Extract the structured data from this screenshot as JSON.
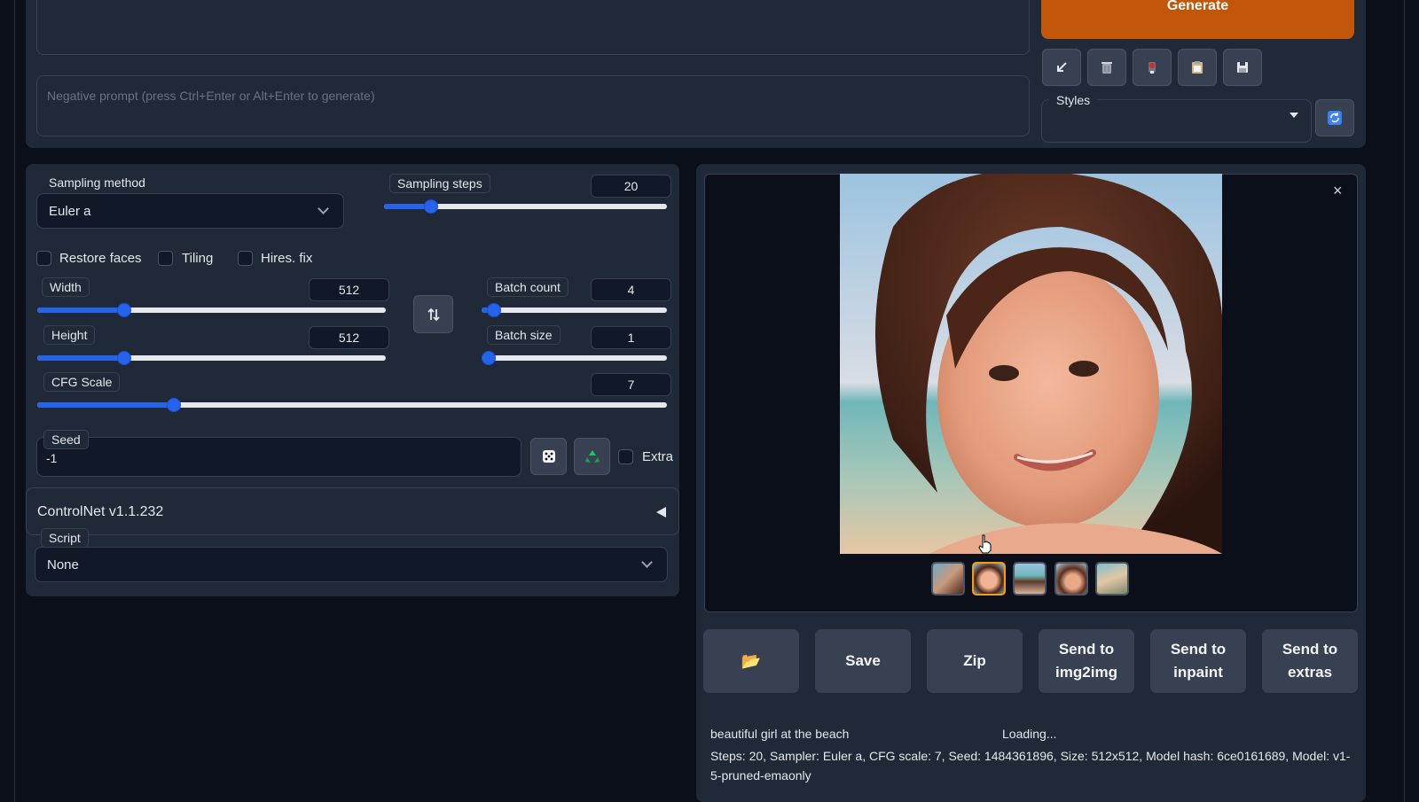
{
  "prompt": {
    "negative_placeholder": "Negative prompt (press Ctrl+Enter or Alt+Enter to generate)"
  },
  "generate_label": "Generate",
  "styles_label": "Styles",
  "toolbar_icons": [
    "arrow-down-left-icon",
    "trash-icon",
    "red-button-icon",
    "clipboard-icon",
    "floppy-disk-icon"
  ],
  "sampling": {
    "method_label": "Sampling method",
    "method_value": "Euler a",
    "steps_label": "Sampling steps",
    "steps_value": "20",
    "steps_fraction": 0.15
  },
  "checkboxes": {
    "restore_faces": "Restore faces",
    "tiling": "Tiling",
    "hires_fix": "Hires. fix"
  },
  "width": {
    "label": "Width",
    "value": "512",
    "fraction": 0.24
  },
  "height": {
    "label": "Height",
    "value": "512",
    "fraction": 0.24
  },
  "batch_count": {
    "label": "Batch count",
    "value": "4",
    "fraction": 0.03
  },
  "batch_size": {
    "label": "Batch size",
    "value": "1",
    "fraction": 0.0
  },
  "cfg": {
    "label": "CFG Scale",
    "value": "7",
    "fraction": 0.21
  },
  "seed": {
    "label": "Seed",
    "value": "-1",
    "extra_label": "Extra"
  },
  "controlnet_label": "ControlNet v1.1.232",
  "script": {
    "label": "Script",
    "value": "None"
  },
  "buttons": {
    "folder": "📂",
    "save": "Save",
    "zip": "Zip",
    "send_img2img": "Send to\nimg2img",
    "send_inpaint": "Send to\ninpaint",
    "send_extras": "Send to\nextras"
  },
  "info": {
    "prompt_text": "beautiful girl at the beach",
    "loading": "Loading...",
    "params": "Steps: 20, Sampler: Euler a, CFG scale: 7, Seed: 1484361896, Size: 512x512, Model hash: 6ce0161689, Model: v1-5-pruned-emaonly"
  },
  "colors": {
    "accent": "#2563eb",
    "generate": "#c2570a",
    "background": "#0b0f19",
    "panel": "#1f2937"
  }
}
